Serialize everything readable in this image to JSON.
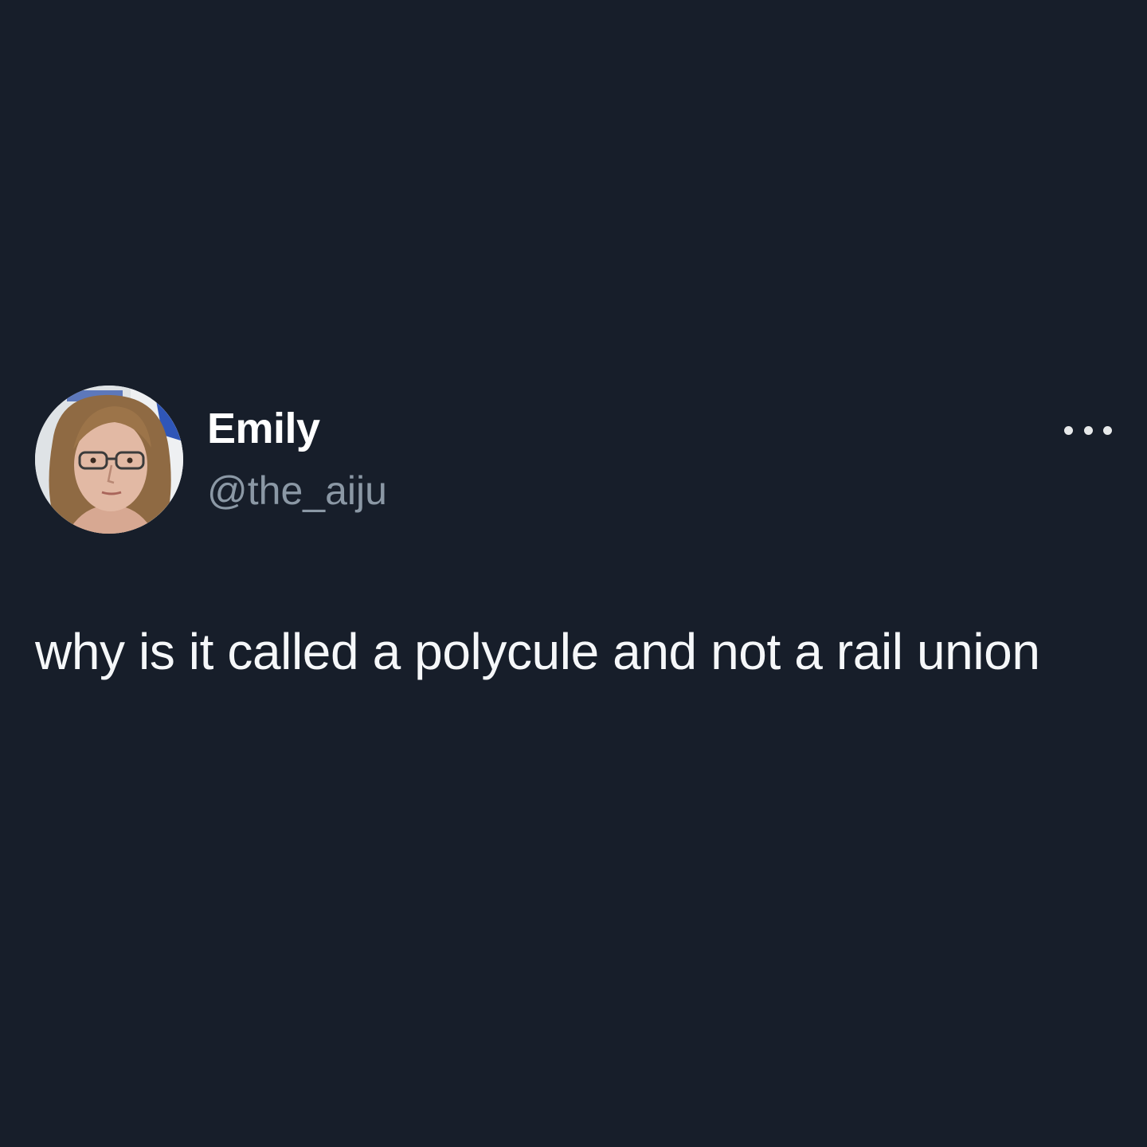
{
  "tweet": {
    "author": {
      "display_name": "Emily",
      "handle": "@the_aiju",
      "avatar_icon": "profile-photo"
    },
    "menu_icon": "more-horizontal-icon",
    "text": "why is it called a polycule and not a rail union"
  },
  "colors": {
    "background": "#171e2a",
    "primary_text": "#ffffff",
    "secondary_text": "#8b98a5"
  }
}
